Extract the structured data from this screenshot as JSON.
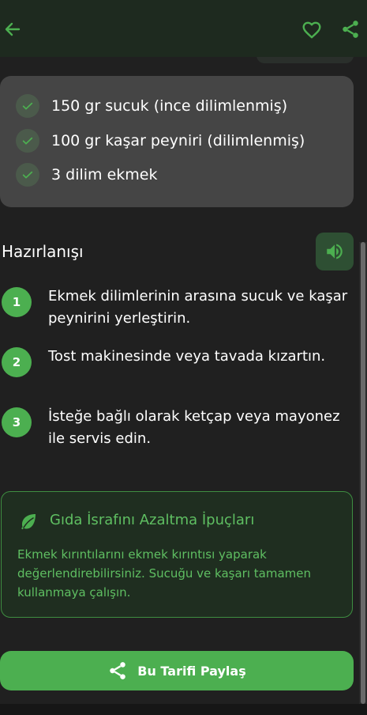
{
  "colors": {
    "accent": "#4caf50",
    "background": "#202020",
    "card": "#454545",
    "tip_text": "#5fbf62"
  },
  "header": {
    "back_icon": "arrow-left-icon",
    "favorite_icon": "heart-outline-icon",
    "share_icon": "share-icon"
  },
  "ingredients": [
    {
      "text": "150 gr sucuk (ince dilimlenmiş)",
      "checked": true
    },
    {
      "text": "100 gr kaşar peyniri (dilimlenmiş)",
      "checked": true
    },
    {
      "text": "3 dilim ekmek",
      "checked": true
    }
  ],
  "preparation": {
    "title": "Hazırlanışı",
    "speaker_icon": "volume-icon",
    "steps": [
      {
        "number": "1",
        "text": "Ekmek dilimlerinin arasına sucuk ve kaşar peynirini yerleştirin."
      },
      {
        "number": "2",
        "text": "Tost makinesinde veya tavada kızartın."
      },
      {
        "number": "3",
        "text": "İsteğe bağlı olarak ketçap veya mayonez ile servis edin."
      }
    ]
  },
  "tips": {
    "icon": "leaf-icon",
    "title": "Gıda İsrafını Azaltma İpuçları",
    "body": "Ekmek kırıntılarını ekmek kırıntısı yaparak değerlendirebilirsiniz.  Sucuğu ve kaşarı tamamen kullanmaya çalışın."
  },
  "share_button": {
    "icon": "share-icon",
    "label": "Bu Tarifi Paylaş"
  }
}
